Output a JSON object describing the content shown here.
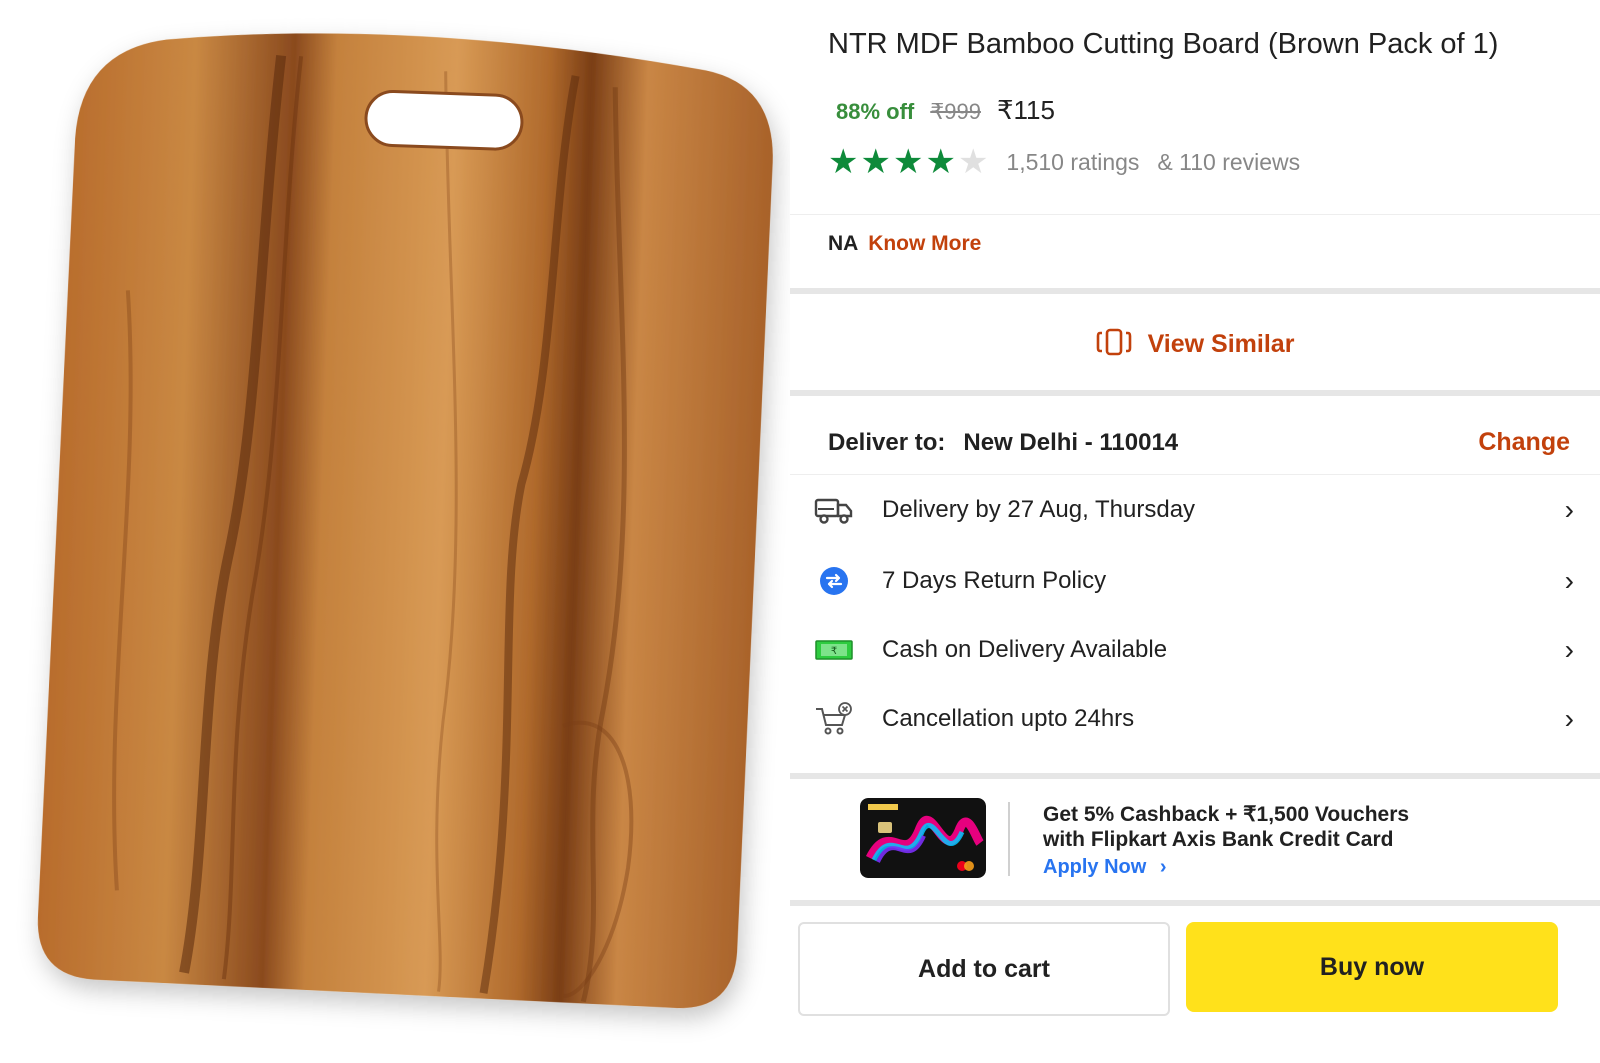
{
  "product": {
    "title": "NTR MDF Bamboo Cutting Board (Brown Pack of 1)",
    "discount": "88% off",
    "mrp": "₹999",
    "price": "₹115",
    "rating_value": 4,
    "rating_max": 5,
    "ratings_count": "1,510 ratings",
    "reviews_count": "& 110 reviews",
    "star_color": "#0e8a3a"
  },
  "info": {
    "na": "NA",
    "know_more": "Know More"
  },
  "view_similar": {
    "label": "View Similar",
    "icon": "view-similar-icon"
  },
  "delivery": {
    "deliver_label": "Deliver to:",
    "location": "New Delhi - 110014",
    "change": "Change",
    "rows": [
      {
        "text": "Delivery by 27 Aug, Thursday",
        "icon": "delivery-truck-icon"
      },
      {
        "text": "7 Days Return Policy",
        "icon": "return-policy-icon"
      },
      {
        "text": "Cash on Delivery Available",
        "icon": "cash-icon"
      },
      {
        "text": "Cancellation upto 24hrs",
        "icon": "cart-cancel-icon"
      }
    ]
  },
  "promo": {
    "line1": "Get 5% Cashback + ₹1,500 Vouchers",
    "line2": "with Flipkart Axis Bank Credit Card",
    "apply": "Apply Now",
    "apply_chevron": "›"
  },
  "actions": {
    "add_to_cart": "Add to cart",
    "buy_now": "Buy now"
  },
  "colors": {
    "accent_orange": "#c2410c",
    "discount_green": "#388e3c",
    "buy_yellow": "#ffe11b",
    "link_blue": "#2874f0"
  }
}
